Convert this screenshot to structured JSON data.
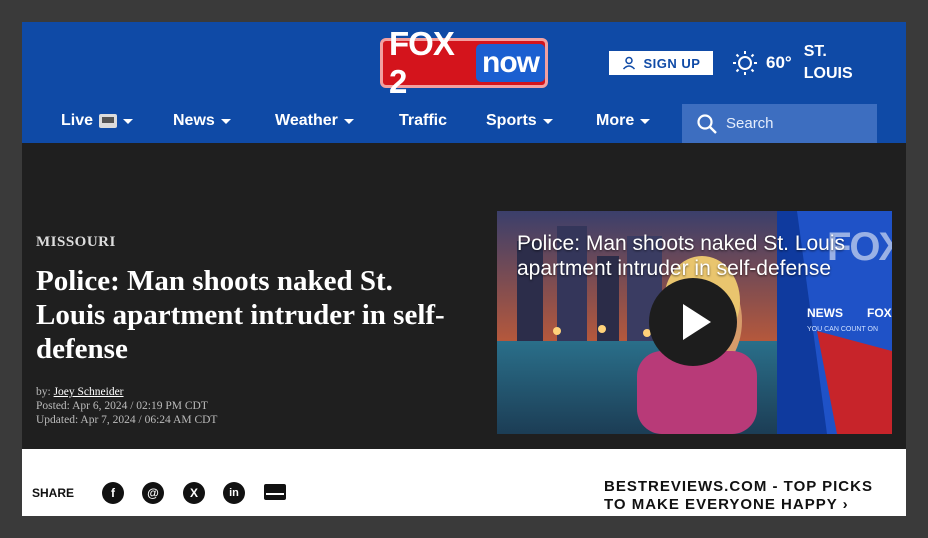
{
  "brand": {
    "fox": "FOX 2",
    "now": "now"
  },
  "header": {
    "signup_label": "SIGN UP",
    "weather": {
      "temp": "60°",
      "city": "ST. LOUIS",
      "icon": "sun-icon"
    }
  },
  "nav": {
    "items": [
      {
        "label": "Live"
      },
      {
        "label": "News"
      },
      {
        "label": "Weather"
      },
      {
        "label": "Traffic"
      },
      {
        "label": "Sports"
      },
      {
        "label": "More"
      }
    ],
    "search_placeholder": "Search"
  },
  "article": {
    "section": "MISSOURI",
    "headline": "Police: Man shoots naked St. Louis apartment intruder in self-defense",
    "byline_prefix": "by:",
    "author": "Joey Schneider",
    "posted": "Posted: Apr 6, 2024 / 02:19 PM CDT",
    "updated": "Updated: Apr 7, 2024 / 06:24 AM CDT"
  },
  "video": {
    "title": "Police: Man shoots naked St. Louis apartment intruder in self-defense",
    "overlay": {
      "fox": "FOX",
      "news": "NEWS",
      "tag": "YOU CAN COUNT ON",
      "fox2": "FOX"
    }
  },
  "share": {
    "label": "SHARE",
    "promo": "BESTREVIEWS.COM - TOP PICKS TO MAKE EVERYONE HAPPY ›"
  },
  "colors": {
    "header_bg": "#0f4aa6",
    "logo_red": "#d4141c",
    "page_bg": "#1f1f1f"
  }
}
